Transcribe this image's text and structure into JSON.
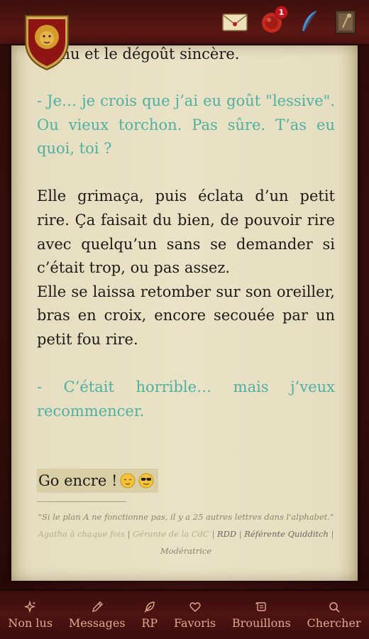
{
  "header": {
    "notification_count": "1",
    "icons": [
      "crest-icon",
      "mail-icon",
      "seal-notification-icon",
      "quill-icon",
      "profile-book-icon"
    ]
  },
  "post": {
    "prev_line": "…enu et le dégoût sincère.",
    "paragraphs": [
      {
        "type": "dialogue",
        "text": "- Je… je crois que j’ai eu goût \"lessive\". Ou vieux torchon. Pas sûre. T’as eu quoi, toi ?"
      },
      {
        "type": "narration",
        "text": "Elle grimaça, puis éclata d’un petit rire. Ça faisait du bien, de pouvoir rire avec quelqu’un sans se demander si c’était trop, ou pas assez."
      },
      {
        "type": "narration",
        "text": "Elle se laissa retomber sur son oreiller, bras en croix, encore secouée par un petit fou rire."
      },
      {
        "type": "dialogue",
        "text": "- C’était horrible… mais j’veux recommencer."
      }
    ],
    "closing": "Go encre !"
  },
  "signature": {
    "quote": "\"Si le plan A ne fonctionne pas, il y a 25 autres lettres dans l'alphabet.\"",
    "role1": "Agatha à chaque fois",
    "role2": "Gérante de la CdC",
    "role3": "RDD",
    "role4": "Référente Quidditch",
    "role5": "Modératrice",
    "sep": "|"
  },
  "nav": {
    "items": [
      {
        "label": "Non lus",
        "icon": "sparkle-icon"
      },
      {
        "label": "Messages",
        "icon": "pen-icon"
      },
      {
        "label": "RP",
        "icon": "feather-icon"
      },
      {
        "label": "Favoris",
        "icon": "heart-icon"
      },
      {
        "label": "Brouillons",
        "icon": "scroll-icon"
      },
      {
        "label": "Chercher",
        "icon": "search-icon"
      }
    ]
  },
  "colors": {
    "dialogue": "#4fb0a2",
    "nav_text": "#e2a88f",
    "frame": "#4e1411",
    "parchment": "#e9e2c6"
  }
}
